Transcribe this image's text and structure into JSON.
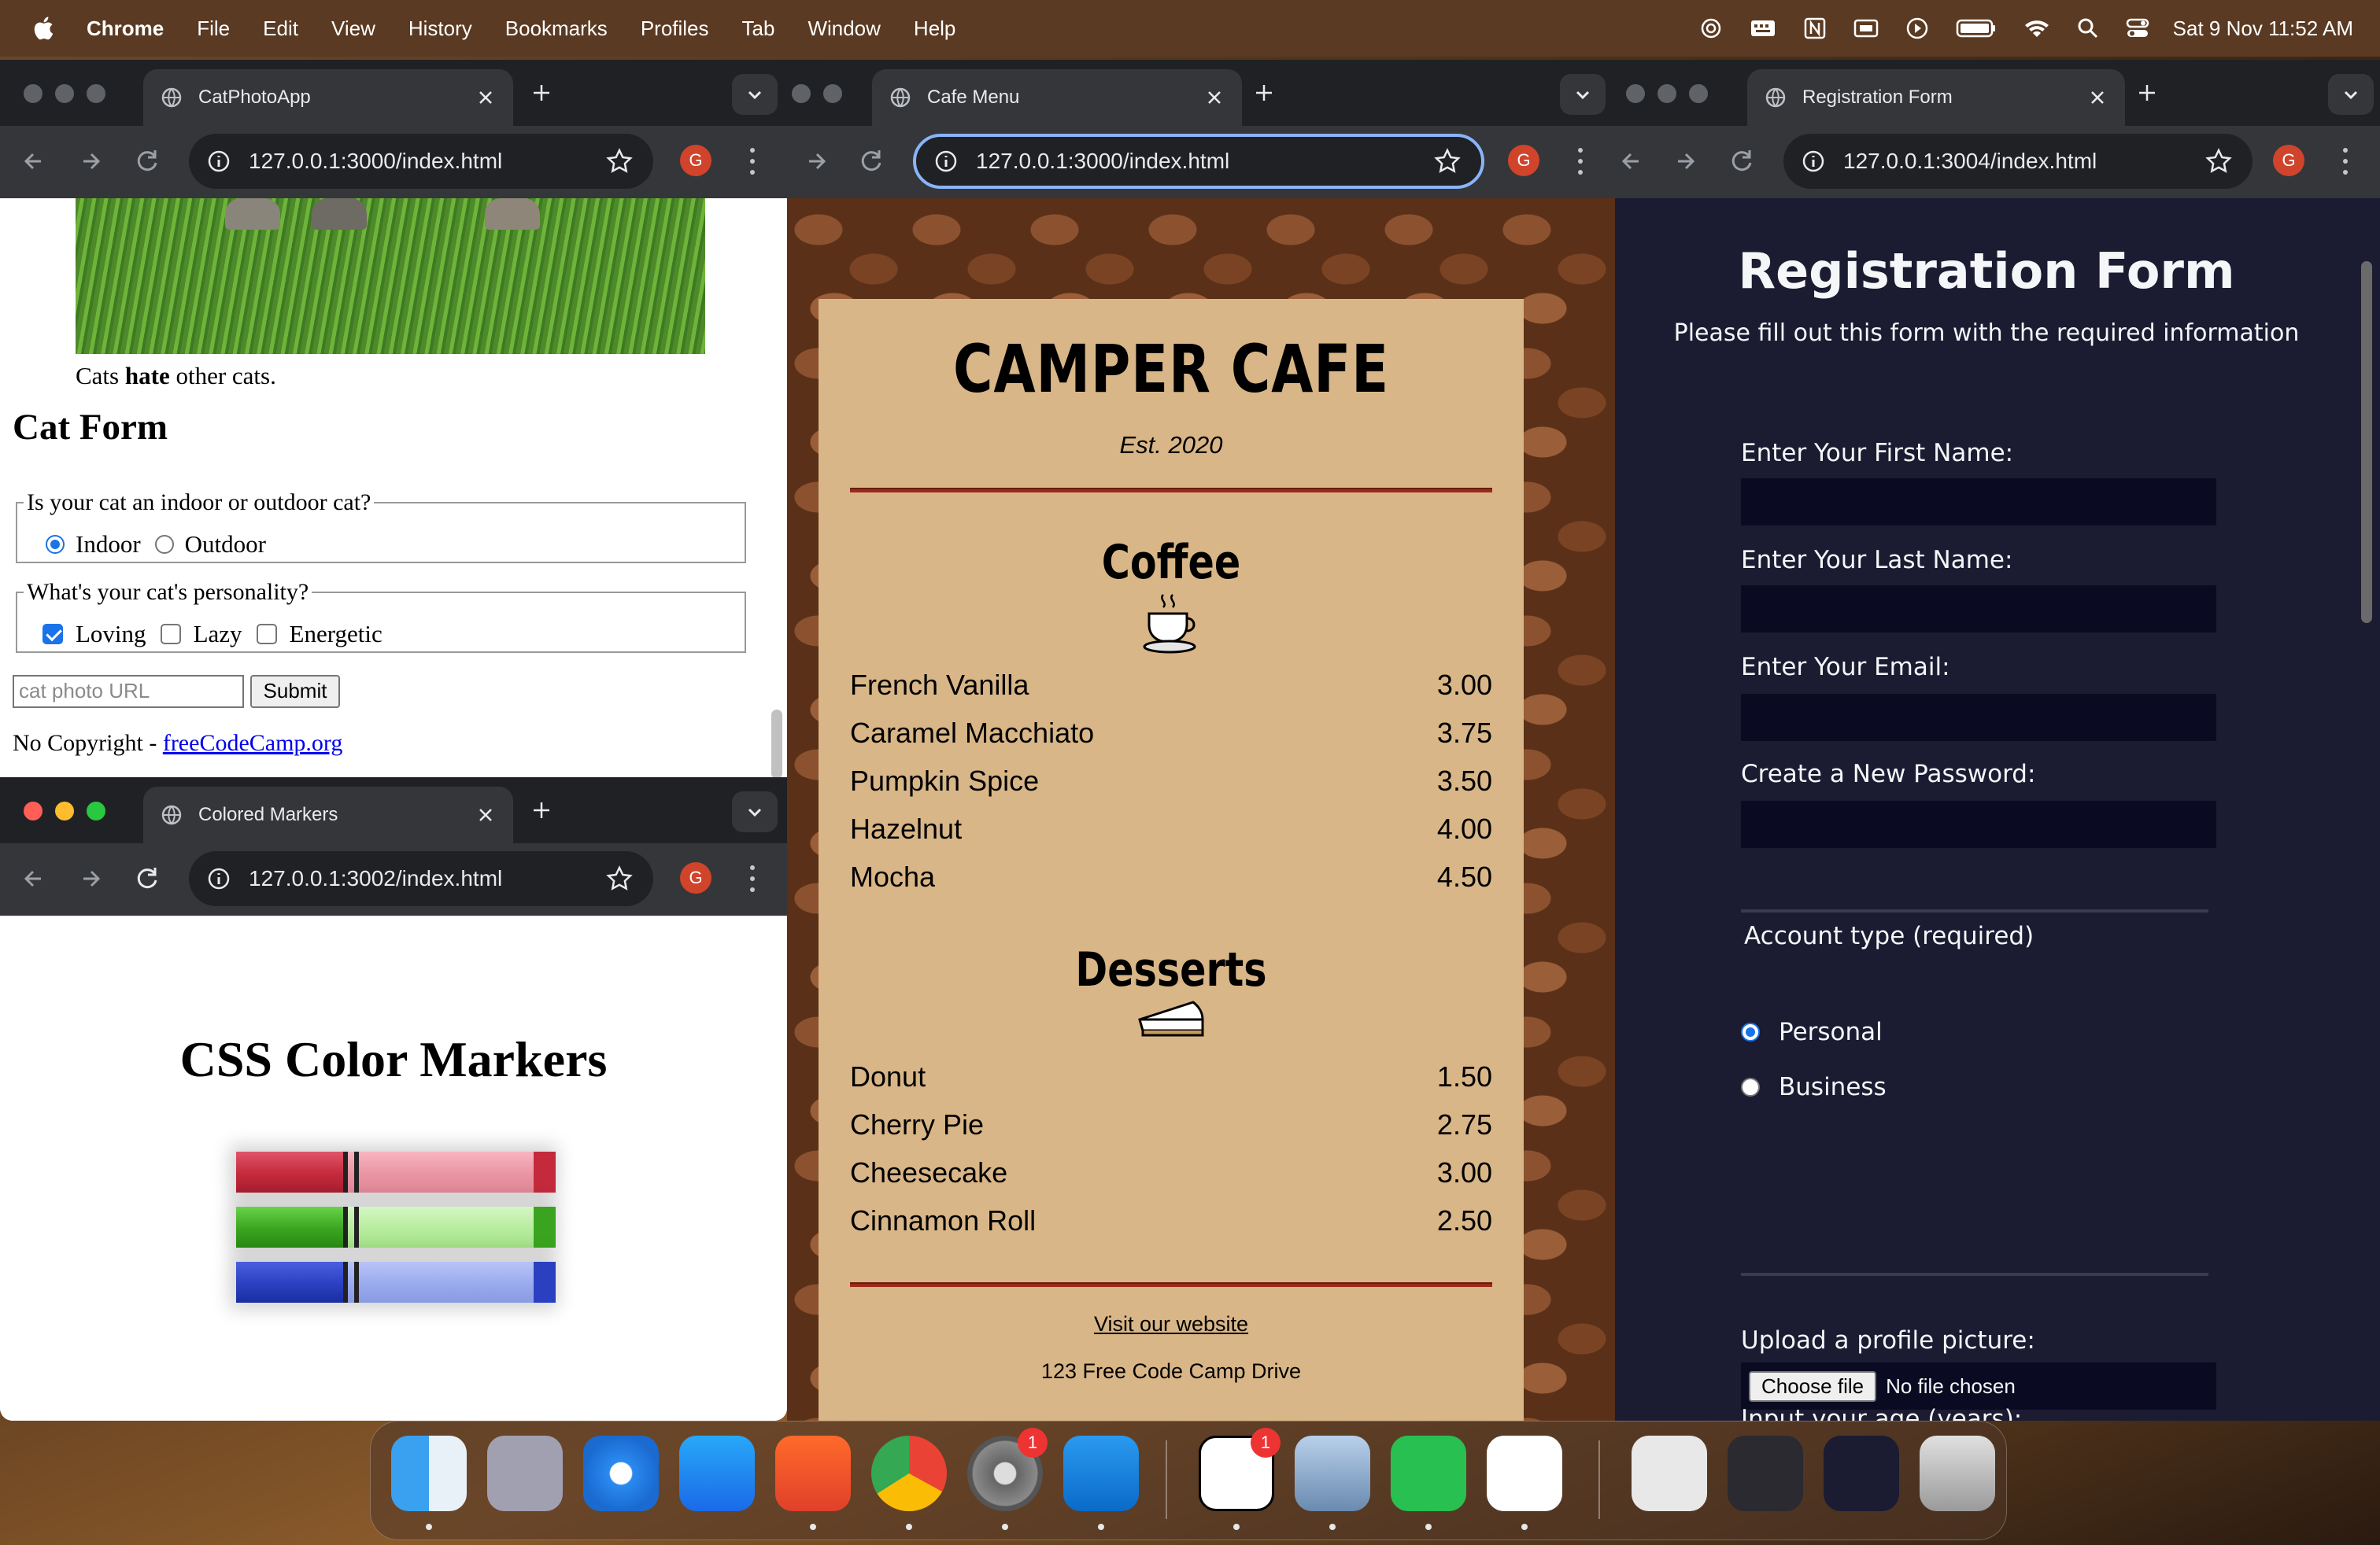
{
  "menubar": {
    "items": [
      "Chrome",
      "File",
      "Edit",
      "View",
      "History",
      "Bookmarks",
      "Profiles",
      "Tab",
      "Window",
      "Help"
    ],
    "clock": "Sat 9 Nov  11:52 AM",
    "status_icons": [
      "chatgpt-icon",
      "keyboard-icon",
      "notion-icon",
      "display-icon",
      "play-icon",
      "battery-icon",
      "wifi-icon",
      "spotlight-icon",
      "control-center-icon"
    ]
  },
  "windows": {
    "cat": {
      "tab_title": "CatPhotoApp",
      "url": "127.0.0.1:3000/index.html",
      "profile": "G",
      "caption_pre": "Cats ",
      "caption_bold": "hate",
      "caption_post": " other cats.",
      "form_title": "Cat Form",
      "fieldset1_legend": "Is your cat an indoor or outdoor cat?",
      "radio_indoor": "Indoor",
      "radio_outdoor": "Outdoor",
      "fieldset2_legend": "What's your cat's personality?",
      "check_loving": "Loving",
      "check_lazy": "Lazy",
      "check_energetic": "Energetic",
      "url_placeholder": "cat photo URL",
      "submit": "Submit",
      "footer_text": "No Copyright - ",
      "footer_link": "freeCodeCamp.org"
    },
    "markers": {
      "tab_title": "Colored Markers",
      "url": "127.0.0.1:3002/index.html",
      "profile": "G",
      "heading": "CSS Color Markers",
      "colors": {
        "red": "#c42a3c",
        "green": "#3aa420",
        "blue": "#2a40c0"
      }
    },
    "cafe": {
      "tab_title": "Cafe Menu",
      "url": "127.0.0.1:3000/index.html",
      "profile": "G",
      "title": "CAMPER CAFE",
      "established": "Est. 2020",
      "coffee_heading": "Coffee",
      "coffee_items": [
        {
          "name": "French Vanilla",
          "price": "3.00"
        },
        {
          "name": "Caramel Macchiato",
          "price": "3.75"
        },
        {
          "name": "Pumpkin Spice",
          "price": "3.50"
        },
        {
          "name": "Hazelnut",
          "price": "4.00"
        },
        {
          "name": "Mocha",
          "price": "4.50"
        }
      ],
      "desserts_heading": "Desserts",
      "dessert_items": [
        {
          "name": "Donut",
          "price": "1.50"
        },
        {
          "name": "Cherry Pie",
          "price": "2.75"
        },
        {
          "name": "Cheesecake",
          "price": "3.00"
        },
        {
          "name": "Cinnamon Roll",
          "price": "2.50"
        }
      ],
      "footer_link": "Visit our website",
      "address": "123 Free Code Camp Drive"
    },
    "registration": {
      "tab_title": "Registration Form",
      "url": "127.0.0.1:3004/index.html",
      "profile": "G",
      "heading": "Registration Form",
      "subtitle": "Please fill out this form with the required information",
      "first_name": "Enter Your First Name:",
      "last_name": "Enter Your Last Name:",
      "email": "Enter Your Email:",
      "password": "Create a New Password:",
      "account_legend": "Account type (required)",
      "personal": "Personal",
      "business": "Business",
      "upload_label": "Upload a profile picture:",
      "choose_file": "Choose file",
      "no_file": "No file chosen",
      "age_label": "Input your age (years):"
    }
  },
  "dock": {
    "apps": [
      "finder-icon",
      "launchpad-icon",
      "safari-icon",
      "app-store-icon",
      "brave-icon",
      "chrome-icon",
      "system-settings-icon",
      "vscode-icon",
      "notion-icon",
      "preview-icon",
      "whatsapp-icon",
      "chatgpt-icon",
      "file-icon",
      "window-thumbnail-icon",
      "window-thumbnail-icon",
      "trash-icon"
    ],
    "badges": {
      "system_settings": "1",
      "notion": "1"
    }
  }
}
